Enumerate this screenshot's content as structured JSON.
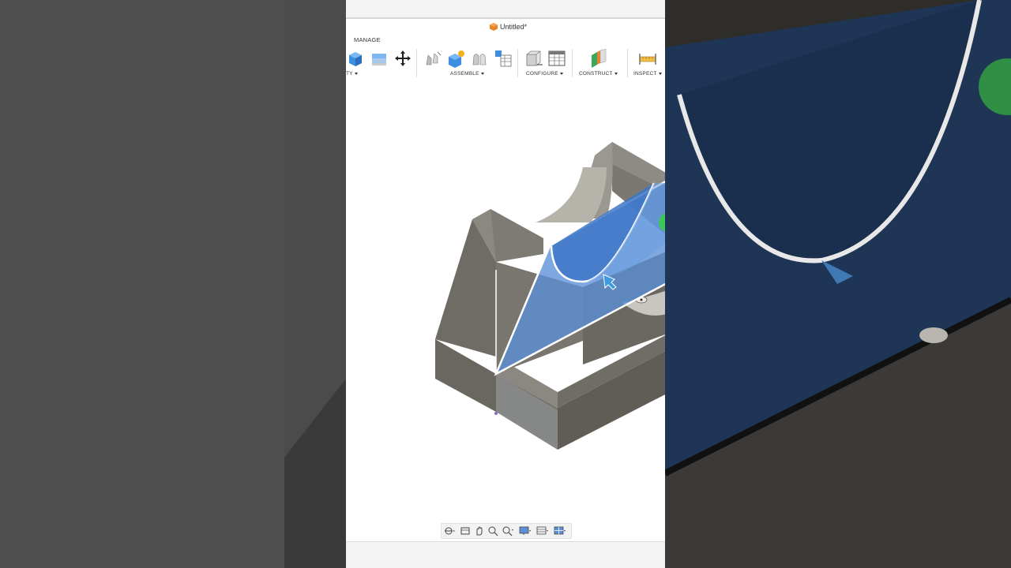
{
  "window": {
    "title": "Untitled*"
  },
  "workspace_tab": "MANAGE",
  "toolbar": {
    "groups": [
      {
        "label": "TY",
        "has_caret": true
      },
      {
        "label": "ASSEMBLE",
        "has_caret": true
      },
      {
        "label": "CONFIGURE",
        "has_caret": true
      },
      {
        "label": "CONSTRUCT",
        "has_caret": true
      },
      {
        "label": "INSPECT",
        "has_caret": true
      }
    ]
  },
  "colors": {
    "accent_blue": "#4a8fd4",
    "plane_blue": "#5b8fd8",
    "model_gray": "#6b6a63",
    "construct_green": "#3aa75a",
    "inspect_orange": "#e8a020"
  },
  "icons": [
    "box-solid-icon",
    "stack-icon",
    "move-icon",
    "joint-icon",
    "new-component-icon",
    "as-built-joint-icon",
    "joint-table-icon",
    "configure-box-icon",
    "configure-table-icon",
    "construct-plane-icon",
    "measure-icon",
    "orbit-icon",
    "look-at-icon",
    "pan-icon",
    "zoom-window-icon",
    "zoom-icon",
    "display-settings-icon",
    "grid-icon",
    "viewports-icon"
  ]
}
